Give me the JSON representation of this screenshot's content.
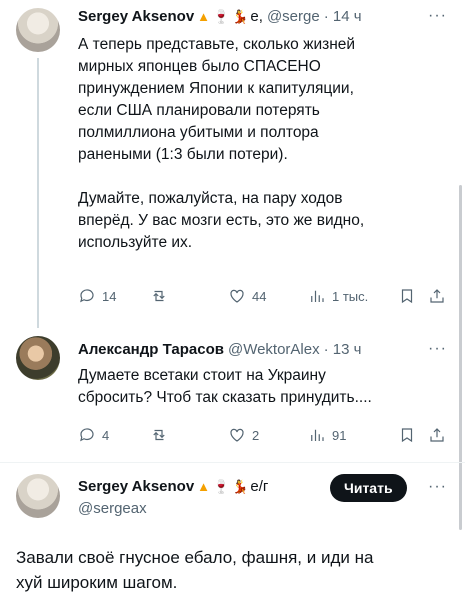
{
  "tweets": [
    {
      "author": "Sergey Aksenov",
      "emoji_tail": "е,",
      "handle": "@serge",
      "time": "· 14 ч",
      "more": "···",
      "text_p1": [
        "А теперь представьте, сколько жизней",
        "мирных японцев было СПАСЕНО",
        "принуждением Японии к капитуляции,",
        "если США планировали потерять",
        "полмиллиона убитыми и полтора",
        "ранеными (1:3 были потери)."
      ],
      "text_p2": [
        "Думайте, пожалуйста, на пару ходов",
        "вперёд. У вас мозги есть, это же видно,",
        "используйте их."
      ],
      "replies": "14",
      "retweets": "",
      "likes": "44",
      "views": "1 тыс."
    },
    {
      "author": "Александр Тарасов",
      "handle": "@WektorAlex",
      "time": "· 13 ч",
      "more": "···",
      "text": [
        "Думаете всетаки стоит на Украину",
        "сбросить? Чтоб так сказать принудить...."
      ],
      "replies": "4",
      "retweets": "",
      "likes": "2",
      "views": "91"
    },
    {
      "author": "Sergey Aksenov",
      "emoji_tail": "е/г",
      "handle": "@sergeax",
      "read_button": "Читать",
      "more": "···",
      "text": [
        "Завали своё гнусное ебало, фашня, и иди на",
        "хуй широким шагом."
      ]
    }
  ],
  "icons": [
    "avatar",
    "warning-triangle-icon",
    "wine-glass-icon",
    "dancer-icon",
    "reply-icon",
    "retweet-icon",
    "like-icon",
    "views-icon",
    "bookmark-icon",
    "share-icon"
  ]
}
